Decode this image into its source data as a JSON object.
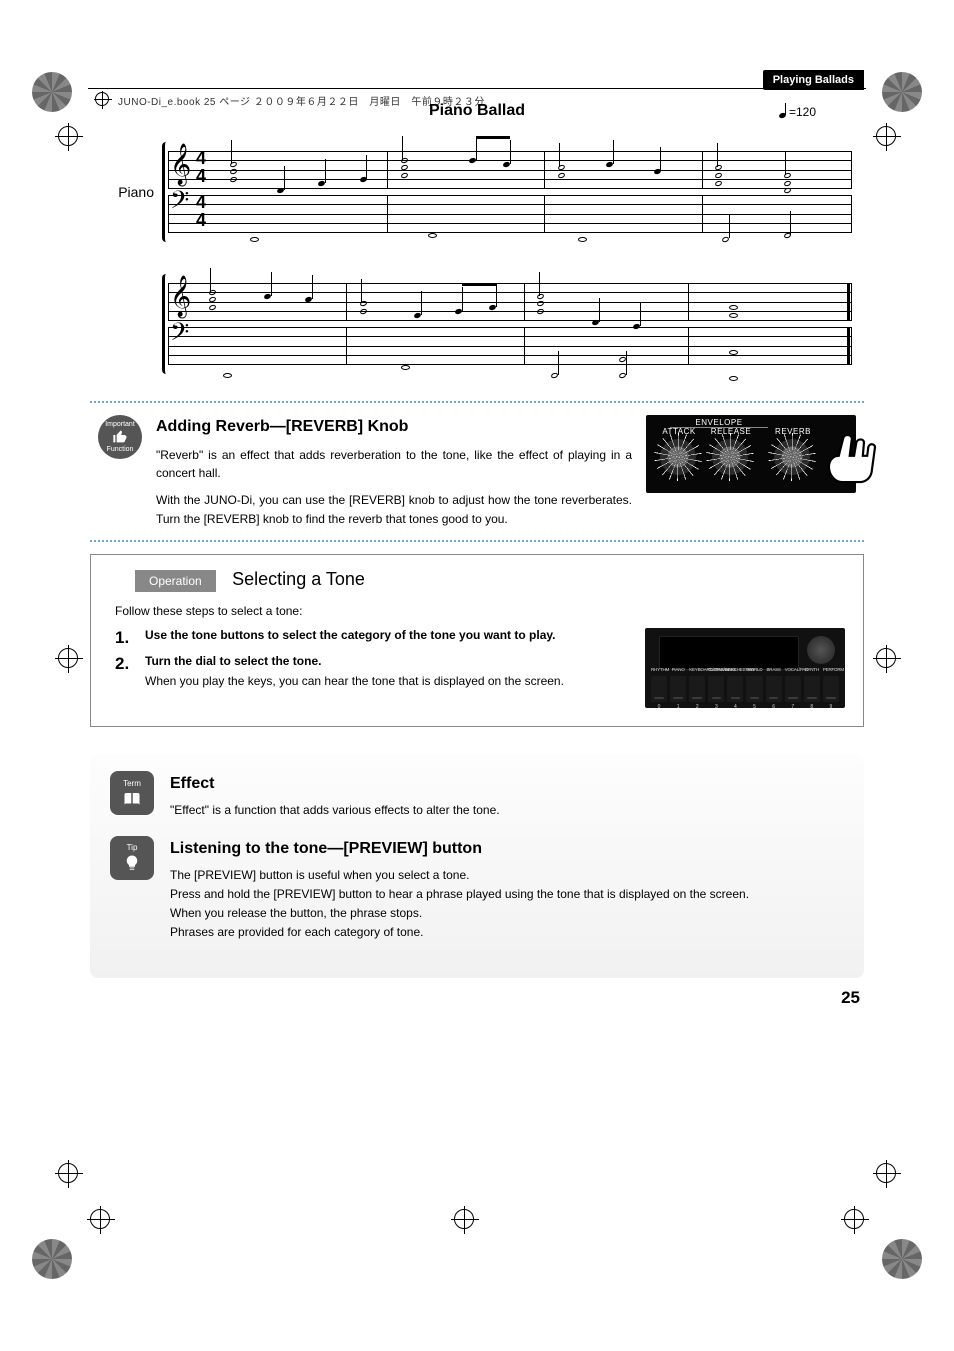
{
  "meta": {
    "book_label": "JUNO-Di_e.book 25 ページ ２００９年６月２２日　月曜日　午前９時２３分"
  },
  "header": {
    "section": "Playing Ballads"
  },
  "score": {
    "title": "Piano Ballad",
    "tempo_label": " =120",
    "instrument": "Piano"
  },
  "reverb": {
    "badge_top": "Important",
    "badge_bottom": "Function",
    "heading": "Adding Reverb—[REVERB] Knob",
    "p1": "\"Reverb\" is an effect that adds reverberation to the tone, like the effect of playing in a concert hall.",
    "p2": "With the JUNO-Di, you can use the [REVERB] knob to adjust how the tone reverberates. Turn the [REVERB] knob to find the reverb that tones good to you.",
    "panel": {
      "group": "ENVELOPE",
      "k1": "ATTACK",
      "k2": "RELEASE",
      "k3": "REVERB"
    }
  },
  "operation": {
    "tag": "Operation",
    "title": "Selecting a Tone",
    "intro": "Follow these steps to select a tone:",
    "steps": [
      {
        "num": "1.",
        "bold": "Use the tone buttons to select the category of the tone you want to play."
      },
      {
        "num": "2.",
        "bold": "Turn the dial to select the tone.",
        "sub": "When you play the keys, you can hear the tone that is displayed on the screen."
      }
    ],
    "buttons": [
      "RHYTHM",
      "PIANO",
      "KEYBOARD/ORGAN",
      "GUITAR/BASS",
      "ORCHESTRA",
      "WORLD",
      "BRASS",
      "VOCAL/PAD",
      "SYNTH",
      "PERFORM"
    ],
    "nums": [
      "0",
      "1",
      "2",
      "3",
      "4",
      "5",
      "6",
      "7",
      "8",
      "9"
    ]
  },
  "effect": {
    "badge": "Term",
    "heading": "Effect",
    "p1": "\"Effect\" is a function that adds various effects to alter the tone."
  },
  "preview": {
    "badge": "Tip",
    "heading": "Listening to the tone—[PREVIEW] button",
    "p1": "The [PREVIEW] button is useful when you select a tone.",
    "p2": "Press and hold the [PREVIEW] button to hear a phrase played using the tone that is displayed on the screen.",
    "p3": "When you release the button, the phrase stops.",
    "p4": "Phrases are provided for each category of tone."
  },
  "page_number": "25"
}
